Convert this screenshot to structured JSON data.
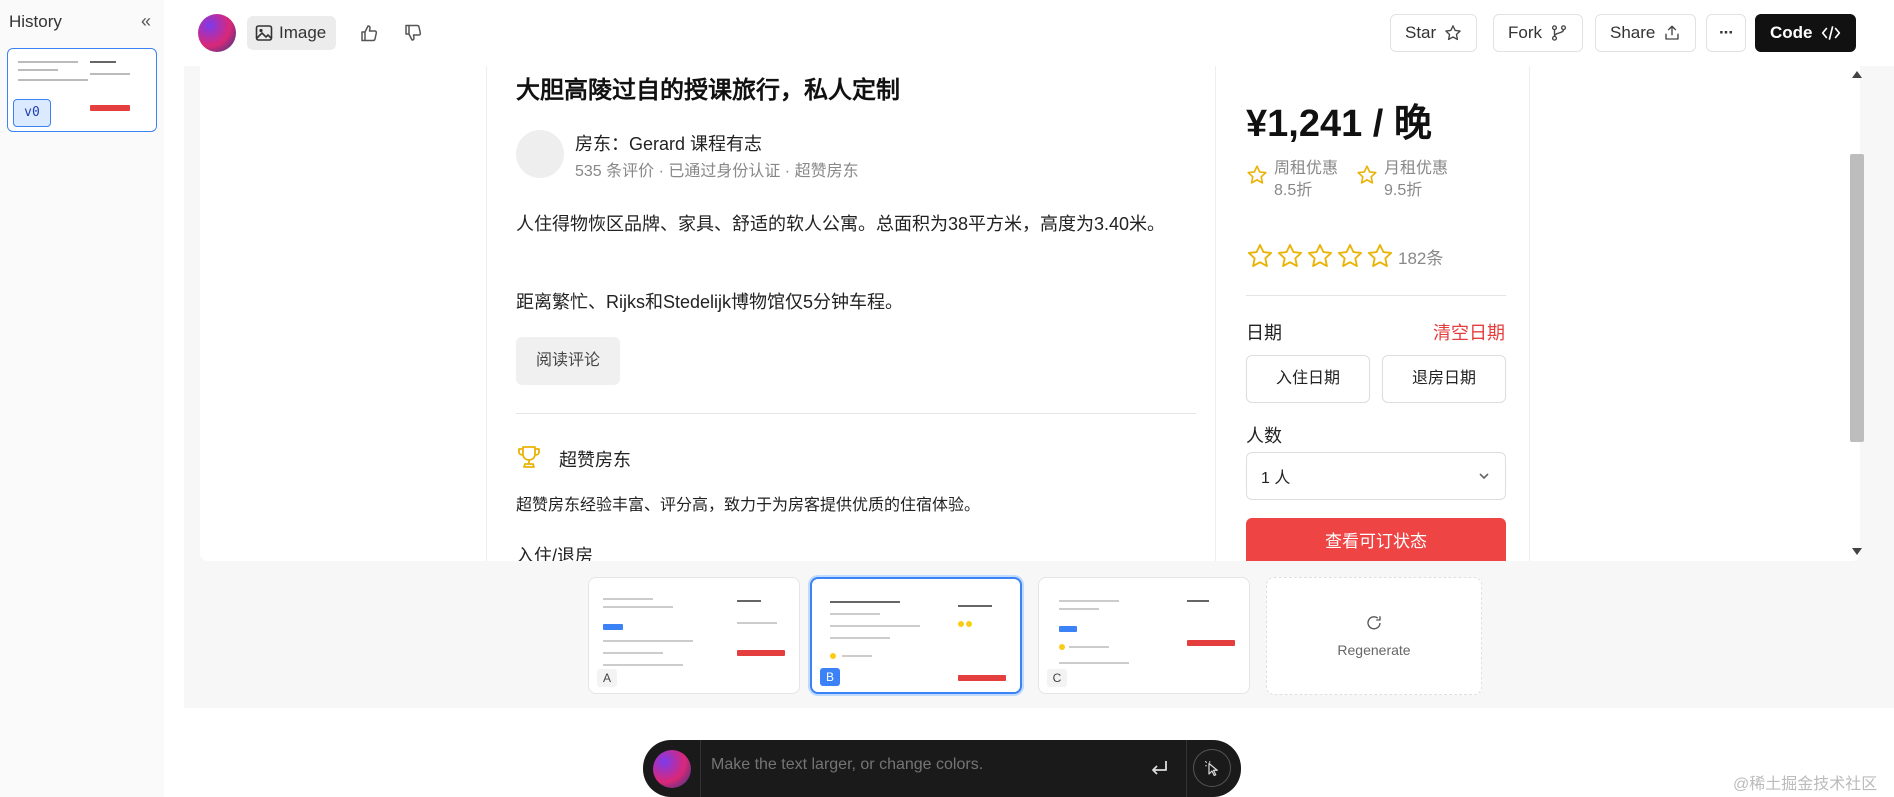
{
  "history": {
    "title": "History",
    "collapse_icon": "chevrons-left-icon",
    "thumbnail_badge": "v0"
  },
  "toolbar": {
    "image_label": "Image",
    "star_label": "Star",
    "fork_label": "Fork",
    "share_label": "Share",
    "more_label": "···",
    "code_label": "Code"
  },
  "listing": {
    "title": "大胆高陵过自的授课旅行，私人定制",
    "host_name": "房东：Gerard 课程有志",
    "host_meta": "535 条评价 · 已通过身份认证 · 超赞房东",
    "description_1": "人住得物恢区品牌、家具、舒适的软人公寓。总面积为38平方米，高度为3.40米。",
    "description_2": "距离繁忙、Rijks和Stedelijk博物馆仅5分钟车程。",
    "read_reviews": "阅读评论",
    "superhost_label": "超赞房东",
    "superhost_desc": "超赞房东经验丰富、评分高，致力于为房客提供优质的住宿体验。",
    "checkin_label": "入住/退房"
  },
  "booking": {
    "price": "¥1,241 / 晚",
    "weekly_discount": "周租优惠 8.5折",
    "monthly_discount": "月租优惠 9.5折",
    "rating_stars": 5,
    "rating_count": "182条",
    "date_label": "日期",
    "clear_dates": "清空日期",
    "checkin_btn": "入住日期",
    "checkout_btn": "退房日期",
    "guests_label": "人数",
    "guests_value": "1 人",
    "check_availability": "查看可订状态"
  },
  "variants": [
    {
      "label": "A"
    },
    {
      "label": "B",
      "active": true
    },
    {
      "label": "C"
    }
  ],
  "regenerate": {
    "label": "Regenerate",
    "icon": "refresh-icon"
  },
  "prompt": {
    "placeholder": "Make the text larger, or change colors."
  },
  "watermark": "@稀土掘金技术社区",
  "colors": {
    "accent_red": "#ef4444",
    "accent_blue": "#3b82f6",
    "star_yellow": "#facc15"
  }
}
